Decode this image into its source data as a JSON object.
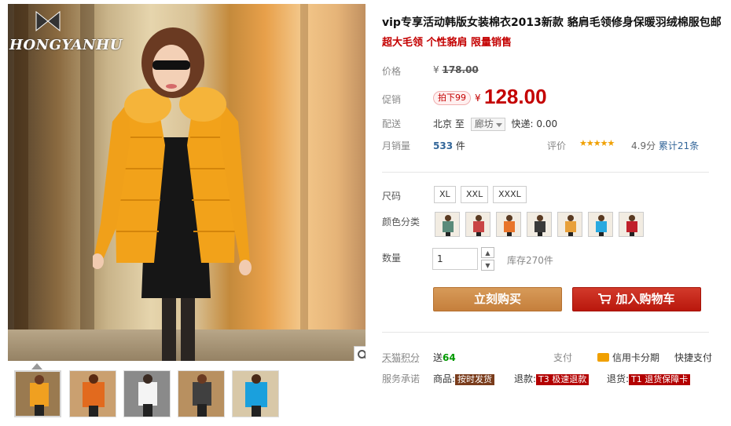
{
  "brand": {
    "logo_text": "HONGYANHU"
  },
  "product": {
    "title": "vip专享活动韩版女装棉衣2013新款 貉肩毛领修身保暖羽绒棉服包邮",
    "subtitle": "超大毛领 个性貉肩 限量销售"
  },
  "price": {
    "label": "价格",
    "currency": "¥",
    "original": "178.00",
    "promo_label": "促销",
    "promo_tag": "拍下99",
    "sale": "128.00"
  },
  "shipping": {
    "label": "配送",
    "from": "北京",
    "to_word": "至",
    "to": "廊坊",
    "express": "快递: 0.00"
  },
  "sales": {
    "label": "月销量",
    "count": "533",
    "unit": "件",
    "rating_label": "评价",
    "stars": "★★★★★",
    "score": "4.9分",
    "reviews": "累计21条"
  },
  "size": {
    "label": "尺码",
    "options": [
      "XL",
      "XXL",
      "XXXL"
    ]
  },
  "color": {
    "label": "颜色分类",
    "swatches": [
      "#5a8a7a",
      "#c94444",
      "#e8742a",
      "#3a3a3a",
      "#e8a03a",
      "#29a9e0",
      "#c0202a"
    ]
  },
  "quantity": {
    "label": "数量",
    "value": "1",
    "stock": "库存270件"
  },
  "actions": {
    "buy": "立刻购买",
    "cart": "加入购物车"
  },
  "points": {
    "label": "天猫积分",
    "prefix": "送",
    "value": "64"
  },
  "payment": {
    "label": "支付",
    "credit": "信用卡分期",
    "express": "快捷支付"
  },
  "promise": {
    "label": "服务承诺",
    "goods_label": "商品:",
    "goods_tag": "按时发货",
    "refund_label": "退款:",
    "refund_tag": "T3 极速退款",
    "return_label": "退货:",
    "return_tag": "T1 退货保障卡"
  },
  "thumbnails": [
    {
      "coat": "#f0a020",
      "bg": "#9a7a50"
    },
    {
      "coat": "#e26a1e",
      "bg": "#caa070"
    },
    {
      "coat": "#f4f4f4",
      "bg": "#8a8a8a"
    },
    {
      "coat": "#404040",
      "bg": "#b89060"
    },
    {
      "coat": "#1aa0dd",
      "bg": "#d8c8a8"
    }
  ],
  "colors": {
    "accent_red": "#c40000",
    "buy_btn": "#c98440",
    "cart_btn": "#c4200f"
  }
}
